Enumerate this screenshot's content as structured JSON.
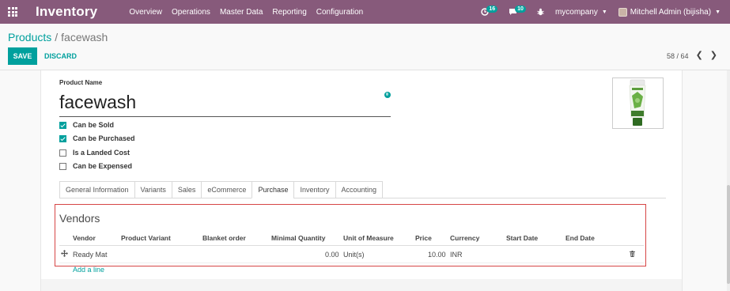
{
  "navbar": {
    "app_name": "Inventory",
    "menu": [
      "Overview",
      "Operations",
      "Master Data",
      "Reporting",
      "Configuration"
    ],
    "activity_count": "16",
    "message_count": "10",
    "company": "mycompany",
    "user": "Mitchell Admin (bijisha)"
  },
  "breadcrumb": {
    "parent": "Products",
    "separator": "/",
    "current": "facewash"
  },
  "buttons": {
    "save": "SAVE",
    "discard": "DISCARD"
  },
  "pager": {
    "value": "58 / 64",
    "prev": "❮",
    "next": "❯"
  },
  "product": {
    "name_label": "Product Name",
    "name": "facewash",
    "flags": [
      {
        "label": "Can be Sold",
        "checked": true
      },
      {
        "label": "Can be Purchased",
        "checked": true
      },
      {
        "label": "Is a Landed Cost",
        "checked": false
      },
      {
        "label": "Can be Expensed",
        "checked": false
      }
    ]
  },
  "tabs": [
    "General Information",
    "Variants",
    "Sales",
    "eCommerce",
    "Purchase",
    "Inventory",
    "Accounting"
  ],
  "active_tab": "Purchase",
  "vendors": {
    "title": "Vendors",
    "columns": [
      "Vendor",
      "Product Variant",
      "Blanket order",
      "Minimal Quantity",
      "Unit of Measure",
      "Price",
      "Currency",
      "Start Date",
      "End Date"
    ],
    "rows": [
      {
        "vendor": "Ready Mat",
        "product_variant": "",
        "blanket_order": "",
        "min_qty": "0.00",
        "uom": "Unit(s)",
        "price": "10.00",
        "currency": "INR",
        "start_date": "",
        "end_date": ""
      }
    ],
    "add_line": "Add a line"
  },
  "colors": {
    "navbar": "#875a7b",
    "primary": "#00a09d",
    "highlight_border": "#d64545"
  }
}
